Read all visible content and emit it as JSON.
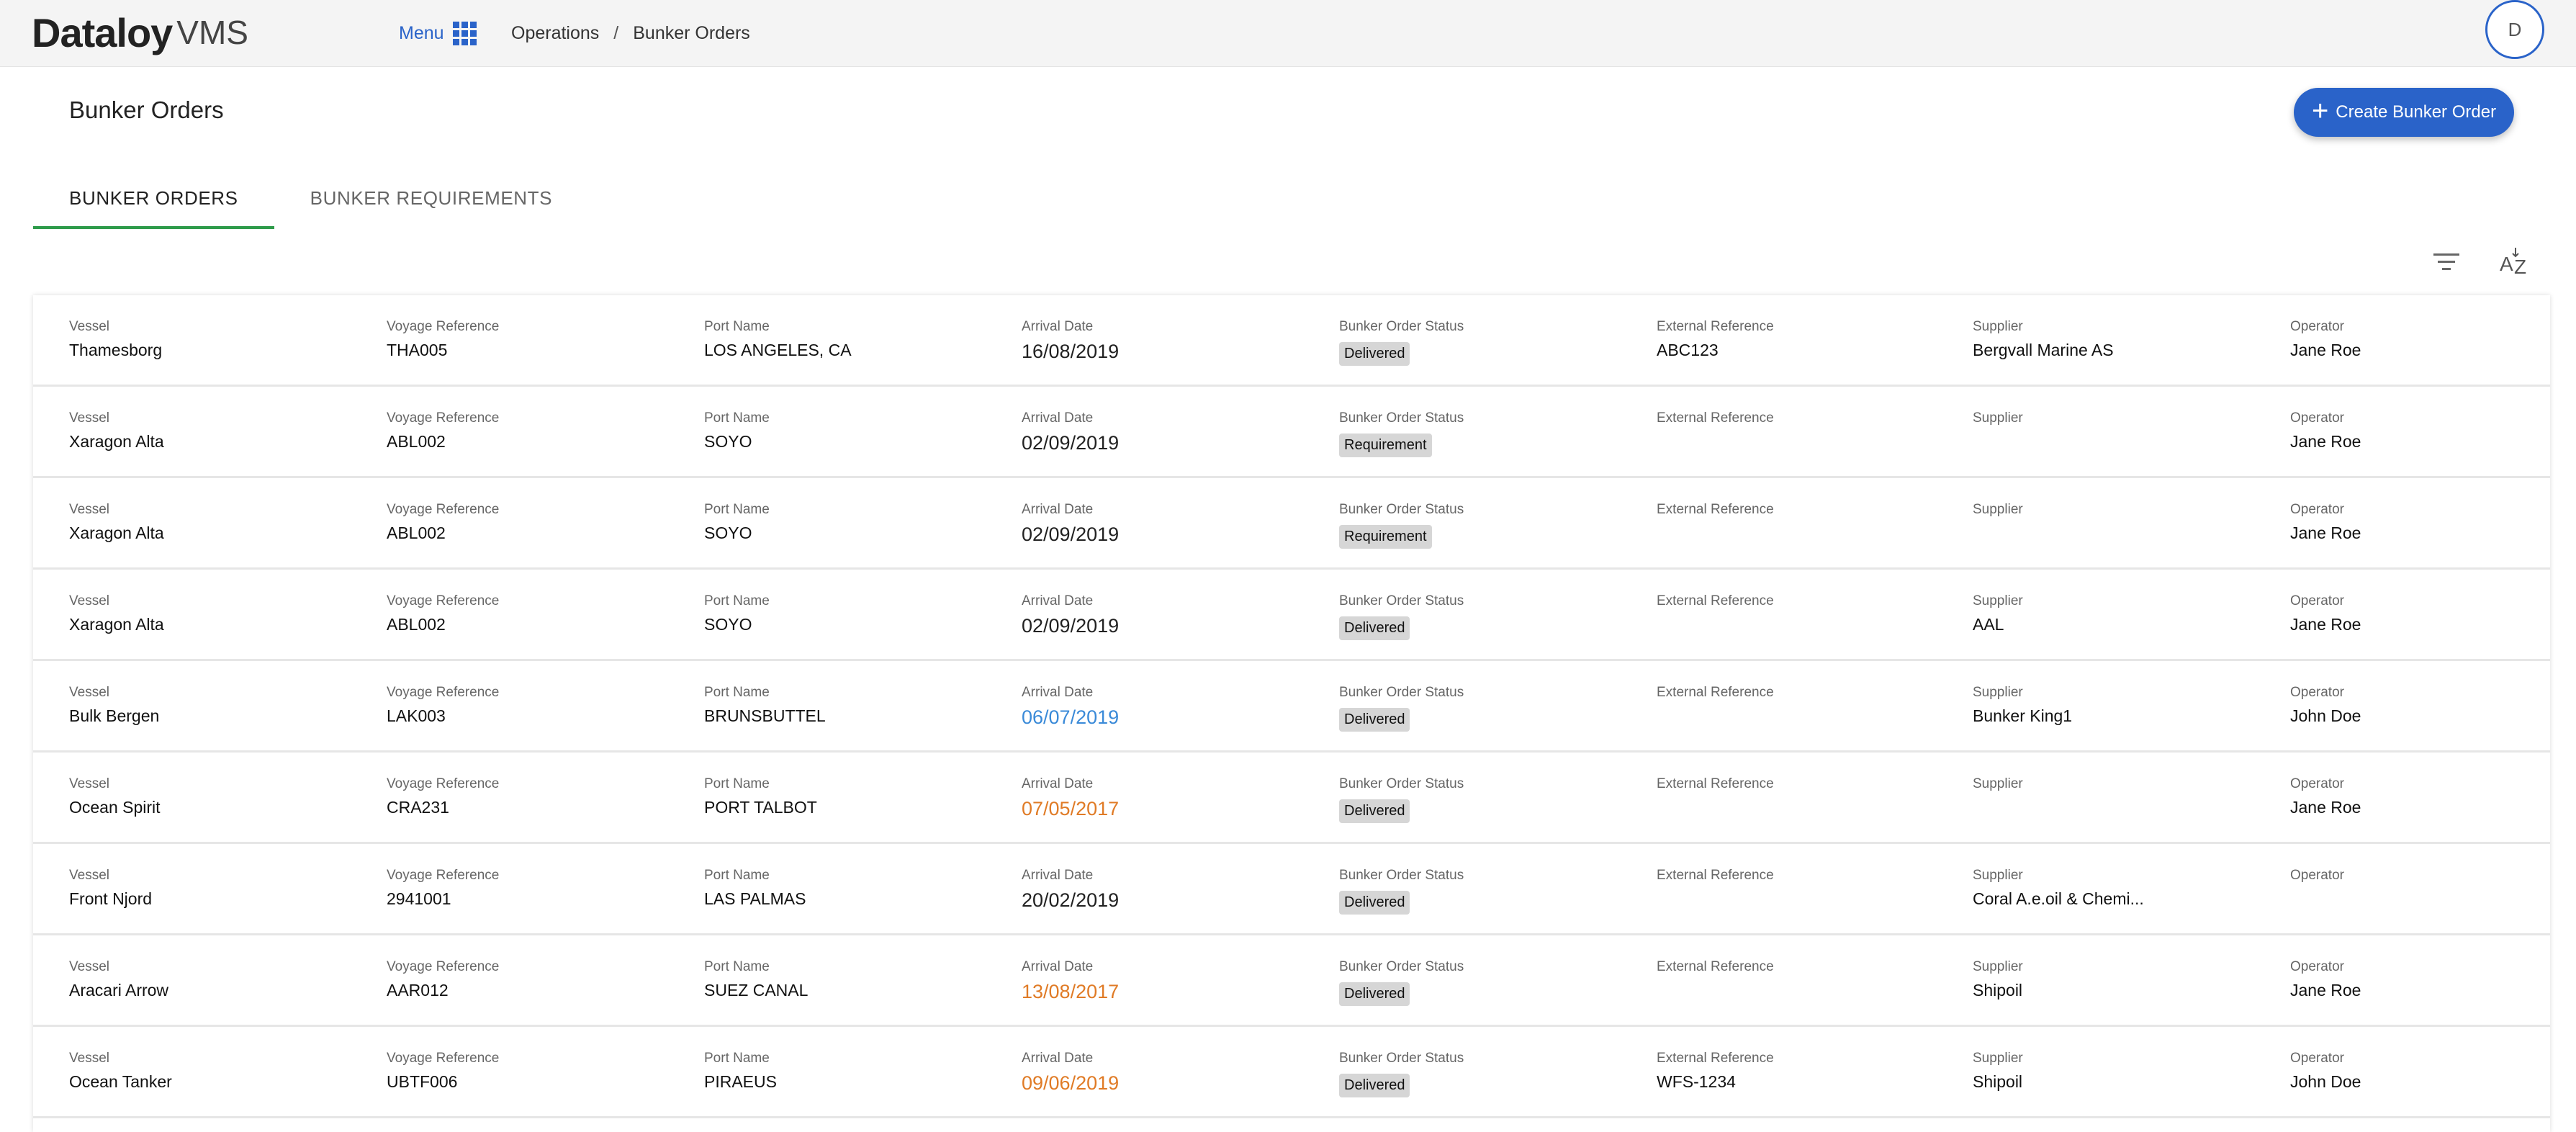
{
  "app": {
    "logo_main": "Dataloy",
    "logo_sub": "VMS",
    "menu_label": "Menu",
    "breadcrumb": [
      "Operations",
      "Bunker Orders"
    ],
    "avatar_initial": "D"
  },
  "page": {
    "title": "Bunker Orders",
    "create_button": "Create Bunker Order"
  },
  "tabs": [
    {
      "label": "BUNKER ORDERS",
      "active": true
    },
    {
      "label": "BUNKER REQUIREMENTS",
      "active": false
    }
  ],
  "columns": {
    "vessel": "Vessel",
    "voyage": "Voyage Reference",
    "port": "Port Name",
    "arrival": "Arrival Date",
    "status": "Bunker Order Status",
    "external": "External Reference",
    "supplier": "Supplier",
    "operator": "Operator"
  },
  "colors": {
    "accent": "#2a63c9",
    "tab_underline": "#2e9b4a",
    "date_blue": "#3a8ad8",
    "date_orange": "#e07b26",
    "badge_bg": "#d6d6d6"
  },
  "rows": [
    {
      "vessel": "Thamesborg",
      "voyage": "THA005",
      "port": "LOS ANGELES, CA",
      "arrival": "16/08/2019",
      "arrival_color": "default",
      "status": "Delivered",
      "external": "ABC123",
      "supplier": "Bergvall Marine AS",
      "operator": "Jane Roe"
    },
    {
      "vessel": "Xaragon Alta",
      "voyage": "ABL002",
      "port": "SOYO",
      "arrival": "02/09/2019",
      "arrival_color": "default",
      "status": "Requirement",
      "external": "",
      "supplier": "",
      "operator": "Jane Roe"
    },
    {
      "vessel": "Xaragon Alta",
      "voyage": "ABL002",
      "port": "SOYO",
      "arrival": "02/09/2019",
      "arrival_color": "default",
      "status": "Requirement",
      "external": "",
      "supplier": "",
      "operator": "Jane Roe"
    },
    {
      "vessel": "Xaragon Alta",
      "voyage": "ABL002",
      "port": "SOYO",
      "arrival": "02/09/2019",
      "arrival_color": "default",
      "status": "Delivered",
      "external": "",
      "supplier": "AAL",
      "operator": "Jane Roe"
    },
    {
      "vessel": "Bulk Bergen",
      "voyage": "LAK003",
      "port": "BRUNSBUTTEL",
      "arrival": "06/07/2019",
      "arrival_color": "blue",
      "status": "Delivered",
      "external": "",
      "supplier": "Bunker King1",
      "operator": "John Doe"
    },
    {
      "vessel": "Ocean Spirit",
      "voyage": "CRA231",
      "port": "PORT TALBOT",
      "arrival": "07/05/2017",
      "arrival_color": "orange",
      "status": "Delivered",
      "external": "",
      "supplier": "",
      "operator": "Jane Roe"
    },
    {
      "vessel": "Front Njord",
      "voyage": "2941001",
      "port": "LAS PALMAS",
      "arrival": "20/02/2019",
      "arrival_color": "default",
      "status": "Delivered",
      "external": "",
      "supplier": "Coral A.e.oil & Chemi...",
      "operator": ""
    },
    {
      "vessel": "Aracari Arrow",
      "voyage": "AAR012",
      "port": "SUEZ CANAL",
      "arrival": "13/08/2017",
      "arrival_color": "orange",
      "status": "Delivered",
      "external": "",
      "supplier": "Shipoil",
      "operator": "Jane Roe"
    },
    {
      "vessel": "Ocean Tanker",
      "voyage": "UBTF006",
      "port": "PIRAEUS",
      "arrival": "09/06/2019",
      "arrival_color": "orange",
      "status": "Delivered",
      "external": "WFS-1234",
      "supplier": "Shipoil",
      "operator": "John Doe"
    }
  ]
}
